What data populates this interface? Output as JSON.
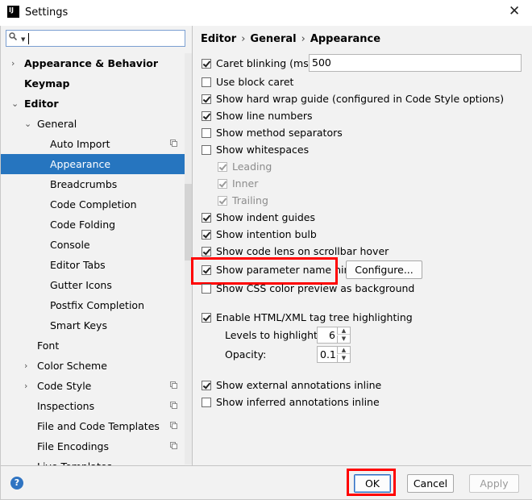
{
  "window": {
    "title": "Settings",
    "app_icon": "IJ"
  },
  "search": {
    "placeholder": "",
    "value": ""
  },
  "tree": [
    {
      "label": "Appearance & Behavior",
      "level": 0,
      "arrow": "›",
      "bold": true
    },
    {
      "label": "Keymap",
      "level": 0,
      "arrow": "",
      "bold": true
    },
    {
      "label": "Editor",
      "level": 0,
      "arrow": "⌄",
      "bold": true
    },
    {
      "label": "General",
      "level": 1,
      "arrow": "⌄"
    },
    {
      "label": "Auto Import",
      "level": 2,
      "copy": true
    },
    {
      "label": "Appearance",
      "level": 2,
      "selected": true
    },
    {
      "label": "Breadcrumbs",
      "level": 2
    },
    {
      "label": "Code Completion",
      "level": 2
    },
    {
      "label": "Code Folding",
      "level": 2
    },
    {
      "label": "Console",
      "level": 2
    },
    {
      "label": "Editor Tabs",
      "level": 2
    },
    {
      "label": "Gutter Icons",
      "level": 2
    },
    {
      "label": "Postfix Completion",
      "level": 2
    },
    {
      "label": "Smart Keys",
      "level": 2
    },
    {
      "label": "Font",
      "level": 1
    },
    {
      "label": "Color Scheme",
      "level": 1,
      "arrow": "›"
    },
    {
      "label": "Code Style",
      "level": 1,
      "arrow": "›",
      "copy": true
    },
    {
      "label": "Inspections",
      "level": 1,
      "copy": true
    },
    {
      "label": "File and Code Templates",
      "level": 1,
      "copy": true
    },
    {
      "label": "File Encodings",
      "level": 1,
      "copy": true
    },
    {
      "label": "Live Templates",
      "level": 1
    }
  ],
  "breadcrumb": {
    "part1": "Editor",
    "part2": "General",
    "part3": "Appearance",
    "sep": "›"
  },
  "options": {
    "caret_blinking": {
      "label": "Caret blinking (ms):",
      "checked": true,
      "value": "500"
    },
    "block_caret": {
      "label": "Use block caret",
      "checked": false
    },
    "hard_wrap": {
      "label": "Show hard wrap guide (configured in Code Style options)",
      "checked": true
    },
    "line_numbers": {
      "label": "Show line numbers",
      "checked": true
    },
    "method_separators": {
      "label": "Show method separators",
      "checked": false
    },
    "whitespaces": {
      "label": "Show whitespaces",
      "checked": false
    },
    "leading": {
      "label": "Leading",
      "checked": true,
      "disabled": true
    },
    "inner": {
      "label": "Inner",
      "checked": true,
      "disabled": true
    },
    "trailing": {
      "label": "Trailing",
      "checked": true,
      "disabled": true
    },
    "indent_guides": {
      "label": "Show indent guides",
      "checked": true
    },
    "intention_bulb": {
      "label": "Show intention bulb",
      "checked": true
    },
    "code_lens": {
      "label": "Show code lens on scrollbar hover",
      "checked": true
    },
    "param_hints": {
      "label": "Show parameter name hints",
      "checked": true,
      "configure_label": "Configure..."
    },
    "css_color": {
      "label": "Show CSS color preview as background",
      "checked": false
    },
    "tag_tree": {
      "label": "Enable HTML/XML tag tree highlighting",
      "checked": true
    },
    "levels": {
      "label": "Levels to highlight:",
      "value": "6"
    },
    "opacity": {
      "label": "Opacity:",
      "value": "0.1"
    },
    "external_annotations": {
      "label": "Show external annotations inline",
      "checked": true
    },
    "inferred_annotations": {
      "label": "Show inferred annotations inline",
      "checked": false
    }
  },
  "buttons": {
    "help": "?",
    "ok": "OK",
    "cancel": "Cancel",
    "apply": "Apply"
  },
  "colors": {
    "selection": "#2675bf",
    "highlight": "#ff0000",
    "help": "#2f74c2"
  }
}
